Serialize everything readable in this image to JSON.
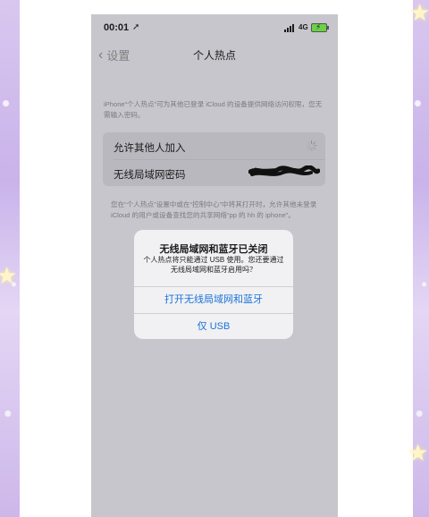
{
  "status_bar": {
    "time": "00:01",
    "location_glyph": "➚",
    "network": "4G",
    "battery_glyph": "⚡"
  },
  "nav": {
    "back_label": "设置",
    "title": "个人热点"
  },
  "hotspot": {
    "description": "iPhone“个人热点”可为其他已登录 iCloud 的设备提供网络访问权限，您无需输入密码。",
    "rows": [
      {
        "label": "允许其他人加入"
      },
      {
        "label": "无线局域网密码"
      }
    ],
    "footer": "您在“个人热点”设置中或在“控制中心”中将其打开时，允许其他未登录 iCloud 的用户或设备查找您的共享网络“pp 的 hh 的 iphone”。"
  },
  "alert": {
    "title": "无线局域网和蓝牙已关闭",
    "message": "个人热点将只能通过 USB 使用。您还要通过无线局域网和蓝牙启用吗？",
    "buttons": [
      "打开无线局域网和蓝牙",
      "仅 USB"
    ]
  },
  "colors": {
    "accent": "#1a73d8",
    "screen_bg": "#c7c6cc",
    "side_bg": "#d9c7ef"
  }
}
